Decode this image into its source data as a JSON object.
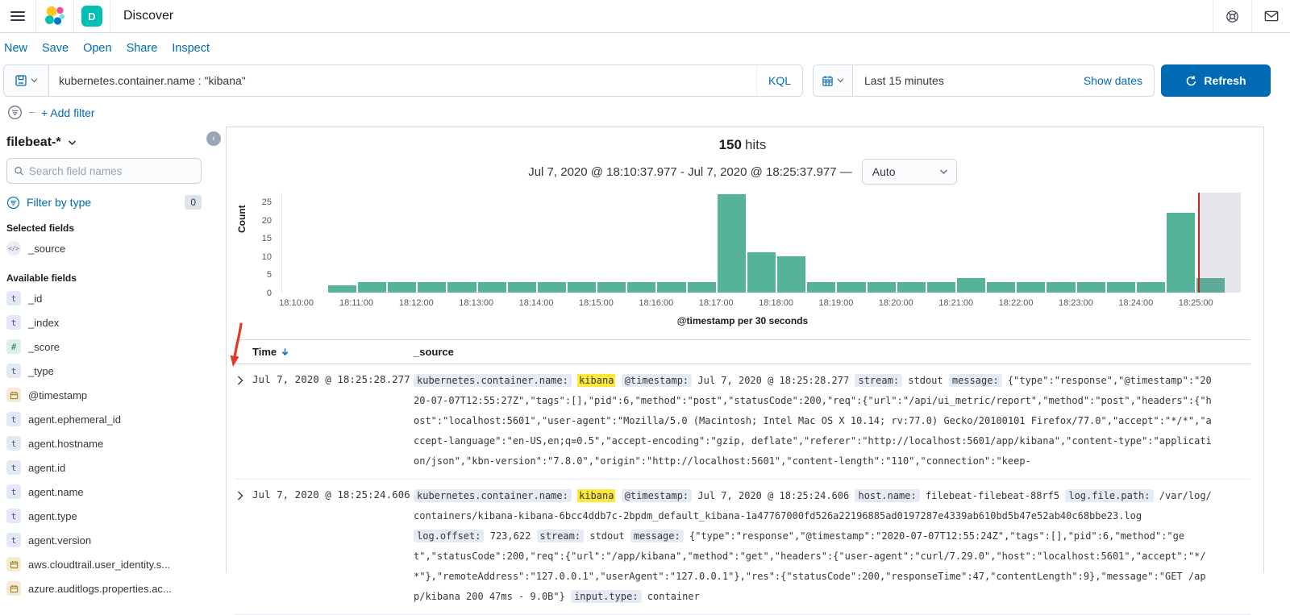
{
  "colors": {
    "primary": "#006BB4",
    "bar_green": "#54B399",
    "time_marker_red": "#BD271E",
    "highlight_yellow": "#FFE936",
    "badge_teal": "#00BFB3",
    "border": "#D3DAE6"
  },
  "header": {
    "app_title": "Discover",
    "space_badge": "D"
  },
  "menu": {
    "items": [
      "New",
      "Save",
      "Open",
      "Share",
      "Inspect"
    ]
  },
  "query_bar": {
    "query": "kubernetes.container.name : \"kibana\"",
    "language_label": "KQL",
    "time_value": "Last 15 minutes",
    "show_dates_label": "Show dates",
    "refresh_label": "Refresh"
  },
  "filter_bar": {
    "add_filter_label": "+ Add filter"
  },
  "sidebar": {
    "index_pattern": "filebeat-*",
    "field_search_placeholder": "Search field names",
    "filter_by_type_label": "Filter by type",
    "filter_by_type_count": "0",
    "selected_heading": "Selected fields",
    "selected_fields": [
      {
        "token": "source",
        "name": "_source"
      }
    ],
    "available_heading": "Available fields",
    "available_fields": [
      {
        "token": "string",
        "name": "_id"
      },
      {
        "token": "string",
        "name": "_index"
      },
      {
        "token": "number",
        "name": "_score"
      },
      {
        "token": "string",
        "name": "_type"
      },
      {
        "token": "date",
        "name": "@timestamp"
      },
      {
        "token": "string",
        "name": "agent.ephemeral_id"
      },
      {
        "token": "string",
        "name": "agent.hostname"
      },
      {
        "token": "string",
        "name": "agent.id"
      },
      {
        "token": "string",
        "name": "agent.name"
      },
      {
        "token": "string",
        "name": "agent.type"
      },
      {
        "token": "string",
        "name": "agent.version"
      },
      {
        "token": "date",
        "name": "aws.cloudtrail.user_identity.s..."
      },
      {
        "token": "date",
        "name": "azure.auditlogs.properties.ac..."
      }
    ]
  },
  "results": {
    "hits_count": "150",
    "hits_label": "hits",
    "time_range_label": "Jul 7, 2020 @ 18:10:37.977 - Jul 7, 2020 @ 18:25:37.977 —",
    "interval_value": "Auto"
  },
  "chart_data": {
    "type": "bar",
    "title": "150 hits",
    "ylabel": "Count",
    "xlabel": "@timestamp per 30 seconds",
    "ylim": [
      0,
      27.5
    ],
    "yticks": [
      0,
      5,
      10,
      15,
      20,
      25
    ],
    "x_axis_start": "18:09:45",
    "x_axis_end": "18:25:45",
    "x_tick_labels": [
      "18:10:00",
      "18:11:00",
      "18:12:00",
      "18:13:00",
      "18:14:00",
      "18:15:00",
      "18:16:00",
      "18:17:00",
      "18:18:00",
      "18:19:00",
      "18:20:00",
      "18:21:00",
      "18:22:00",
      "18:23:00",
      "18:24:00",
      "18:25:00"
    ],
    "first_bucket": "18:10:30",
    "bucket_seconds": 30,
    "values": [
      2,
      3,
      3,
      3,
      3,
      3,
      3,
      3,
      3,
      3,
      3,
      3,
      3,
      27,
      11,
      10,
      3,
      3,
      3,
      3,
      3,
      4,
      3,
      3,
      3,
      3,
      3,
      3,
      22,
      4
    ],
    "current_time_marker": "18:25:02",
    "bar_color": "#54B399",
    "marker_color": "#BD271E",
    "legend": "off",
    "grid": "off"
  },
  "table": {
    "headers": {
      "time": "Time",
      "source": "_source"
    },
    "rows": [
      {
        "time": "Jul 7, 2020 @ 18:25:28.277",
        "segments": [
          {
            "t": "field",
            "v": "kubernetes.container.name:"
          },
          {
            "t": "mark",
            "v": "kibana"
          },
          {
            "t": "field",
            "v": "@timestamp:"
          },
          {
            "t": "text",
            "v": "Jul 7, 2020 @ 18:25:28.277"
          },
          {
            "t": "field",
            "v": "stream:"
          },
          {
            "t": "text",
            "v": "stdout"
          },
          {
            "t": "field",
            "v": "message:"
          },
          {
            "t": "long",
            "v": "{\"type\":\"response\",\"@timestamp\":\"2020-07-07T12:55:27Z\",\"tags\":[],\"pid\":6,\"method\":\"post\",\"statusCode\":200,\"req\":{\"url\":\"/api/ui_metric/report\",\"method\":\"post\",\"headers\":{\"host\":\"localhost:5601\",\"user-agent\":\"Mozilla/5.0 (Macintosh; Intel Mac OS X 10.14; rv:77.0) Gecko/20100101 Firefox/77.0\",\"accept\":\"*/*\",\"accept-language\":\"en-US,en;q=0.5\",\"accept-encoding\":\"gzip, deflate\",\"referer\":\"http://localhost:5601/app/kibana\",\"content-type\":\"application/json\",\"kbn-version\":\"7.8.0\",\"origin\":\"http://localhost:5601\",\"content-length\":\"110\",\"connection\":\"keep-"
          }
        ]
      },
      {
        "time": "Jul 7, 2020 @ 18:25:24.606",
        "segments": [
          {
            "t": "field",
            "v": "kubernetes.container.name:"
          },
          {
            "t": "mark",
            "v": "kibana"
          },
          {
            "t": "field",
            "v": "@timestamp:"
          },
          {
            "t": "text",
            "v": "Jul 7, 2020 @ 18:25:24.606"
          },
          {
            "t": "field",
            "v": "host.name:"
          },
          {
            "t": "text",
            "v": "filebeat-filebeat-88rf5"
          },
          {
            "t": "field",
            "v": "log.file.path:"
          },
          {
            "t": "long",
            "v": "/var/log/containers/kibana-kibana-6bcc4ddb7c-2bpdm_default_kibana-1a47767000fd526a22196885ad0197287e4339ab610bd5b47e52ab40c68bbe23.log"
          },
          {
            "t": "field",
            "v": "log.offset:"
          },
          {
            "t": "text",
            "v": "723,622"
          },
          {
            "t": "field",
            "v": "stream:"
          },
          {
            "t": "text",
            "v": "stdout"
          },
          {
            "t": "field",
            "v": "message:"
          },
          {
            "t": "long",
            "v": "{\"type\":\"response\",\"@timestamp\":\"2020-07-07T12:55:24Z\",\"tags\":[],\"pid\":6,\"method\":\"get\",\"statusCode\":200,\"req\":{\"url\":\"/app/kibana\",\"method\":\"get\",\"headers\":{\"user-agent\":\"curl/7.29.0\",\"host\":\"localhost:5601\",\"accept\":\"*/*\"},\"remoteAddress\":\"127.0.0.1\",\"userAgent\":\"127.0.0.1\"},\"res\":{\"statusCode\":200,\"responseTime\":47,\"contentLength\":9},\"message\":\"GET /app/kibana 200 47ms - 9.0B\"}"
          },
          {
            "t": "field",
            "v": "input.type:"
          },
          {
            "t": "text",
            "v": "container"
          }
        ]
      }
    ]
  }
}
